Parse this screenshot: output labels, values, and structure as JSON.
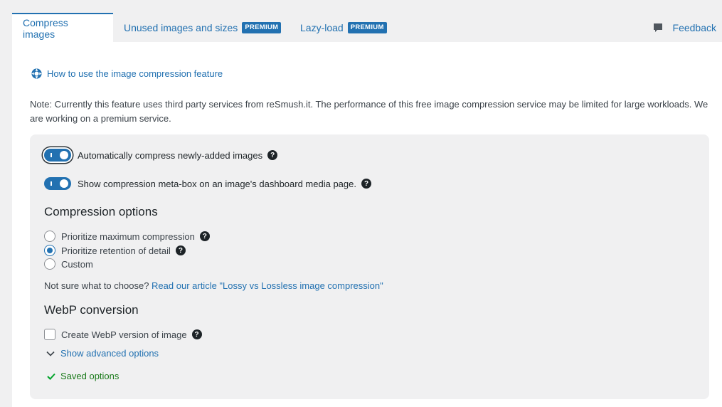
{
  "tabs": [
    {
      "label": "Compress images",
      "active": true
    },
    {
      "label": "Unused images and sizes",
      "badge": "PREMIUM"
    },
    {
      "label": "Lazy-load",
      "badge": "PREMIUM"
    }
  ],
  "feedback": {
    "label": "Feedback",
    "icon": "comment-icon"
  },
  "howto": {
    "label": "How to use the image compression feature",
    "icon": "lifebuoy-icon"
  },
  "note": "Note: Currently this feature uses third party services from reSmush.it. The performance of this free image compression service may be limited for large workloads. We are working on a premium service.",
  "toggles": [
    {
      "label": "Automatically compress newly-added images",
      "on": true
    },
    {
      "label": "Show compression meta-box on an image's dashboard media page.",
      "on": true
    }
  ],
  "compression": {
    "heading": "Compression options",
    "options": [
      {
        "label": "Prioritize maximum compression",
        "checked": false,
        "help": true
      },
      {
        "label": "Prioritize retention of detail",
        "checked": true,
        "help": true
      },
      {
        "label": "Custom",
        "checked": false,
        "help": false
      }
    ],
    "hint_text": "Not sure what to choose?",
    "hint_link": "Read our article \"Lossy vs Lossless image compression\""
  },
  "webp": {
    "heading": "WebP conversion",
    "checkbox_label": "Create WebP version of image",
    "checked": false
  },
  "advanced_label": "Show advanced options",
  "saved_label": "Saved options",
  "help_glyph": "?",
  "colors": {
    "accent": "#2271b1",
    "success": "#00a32a",
    "background": "#f0f0f1"
  }
}
